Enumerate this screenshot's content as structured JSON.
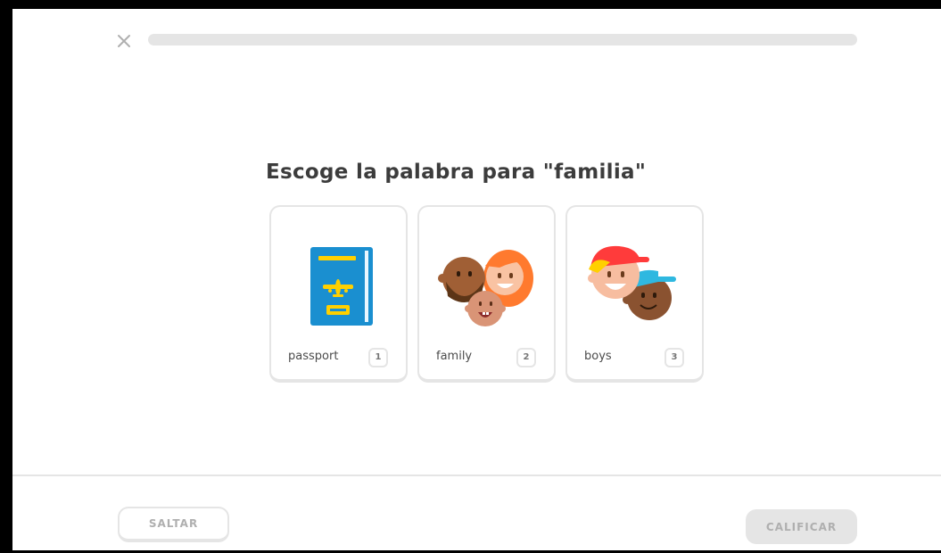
{
  "header": {
    "close_icon": "close-icon",
    "progress_fraction": 0
  },
  "challenge": {
    "prompt": "Escoge la palabra para \"familia\""
  },
  "choices": [
    {
      "label": "passport",
      "key": "1",
      "icon": "passport-icon"
    },
    {
      "label": "family",
      "key": "2",
      "icon": "family-icon"
    },
    {
      "label": "boys",
      "key": "3",
      "icon": "boys-icon"
    }
  ],
  "footer": {
    "skip_label": "SALTAR",
    "check_label": "CALIFICAR"
  },
  "colors": {
    "border": "#e5e5e5",
    "text": "#3c3c3c",
    "disabled_text": "#afafaf"
  }
}
